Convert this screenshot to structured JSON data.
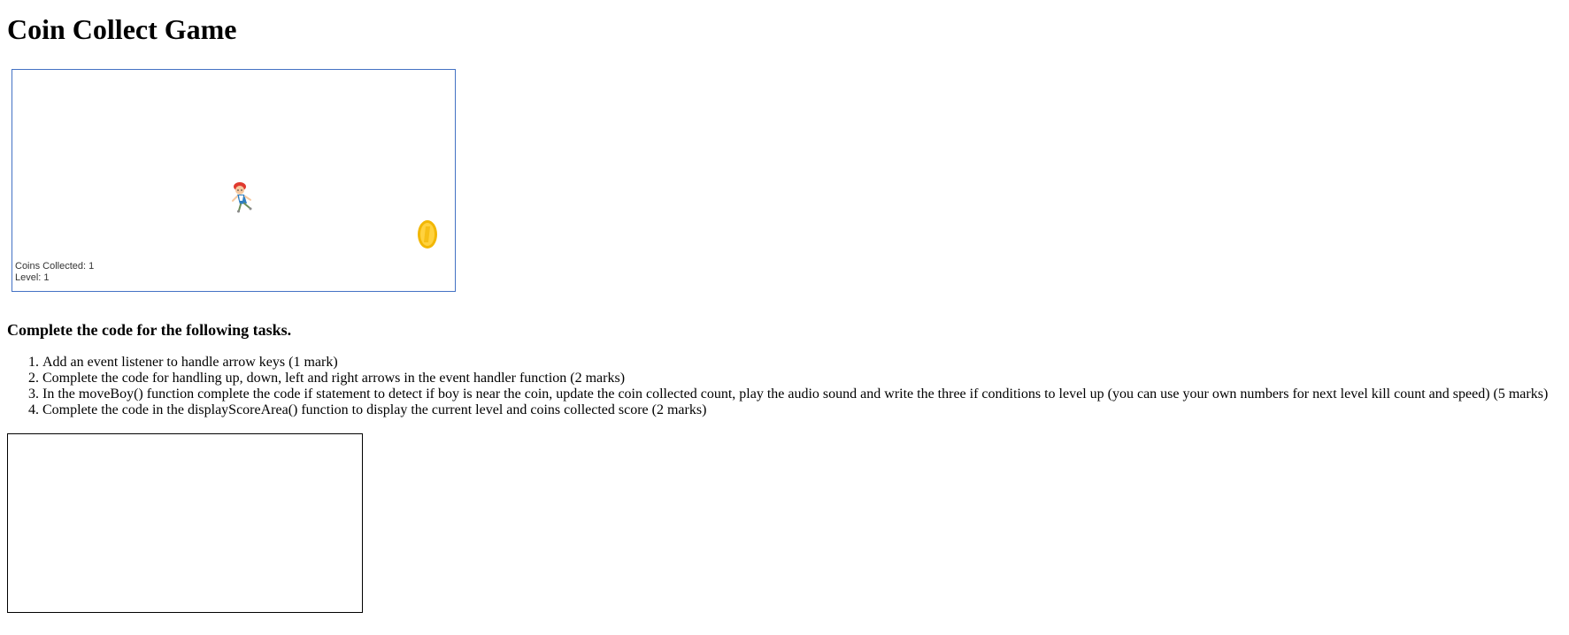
{
  "page": {
    "title": "Coin Collect Game"
  },
  "game": {
    "border_color": "#4472c4",
    "score": {
      "coins_label": "Coins Collected: 1",
      "level_label": "Level: 1"
    },
    "sprites": {
      "player_icon": "boy-character-icon",
      "coin_icon": "gold-coin-icon"
    }
  },
  "tasks": {
    "heading": "Complete the code for the following tasks.",
    "items": [
      "Add an event listener to handle arrow keys (1 mark)",
      "Complete the code for handling up, down, left and right arrows in the event handler function (2 marks)",
      "In the moveBoy() function complete the code if statement to detect if boy is near the coin, update the coin collected count, play the audio sound and write the three if conditions to level up (you can use your own numbers for next level kill count and speed) (5 marks)",
      "Complete the code in the displayScoreArea() function to display the current level and coins collected score (2 marks)"
    ]
  }
}
